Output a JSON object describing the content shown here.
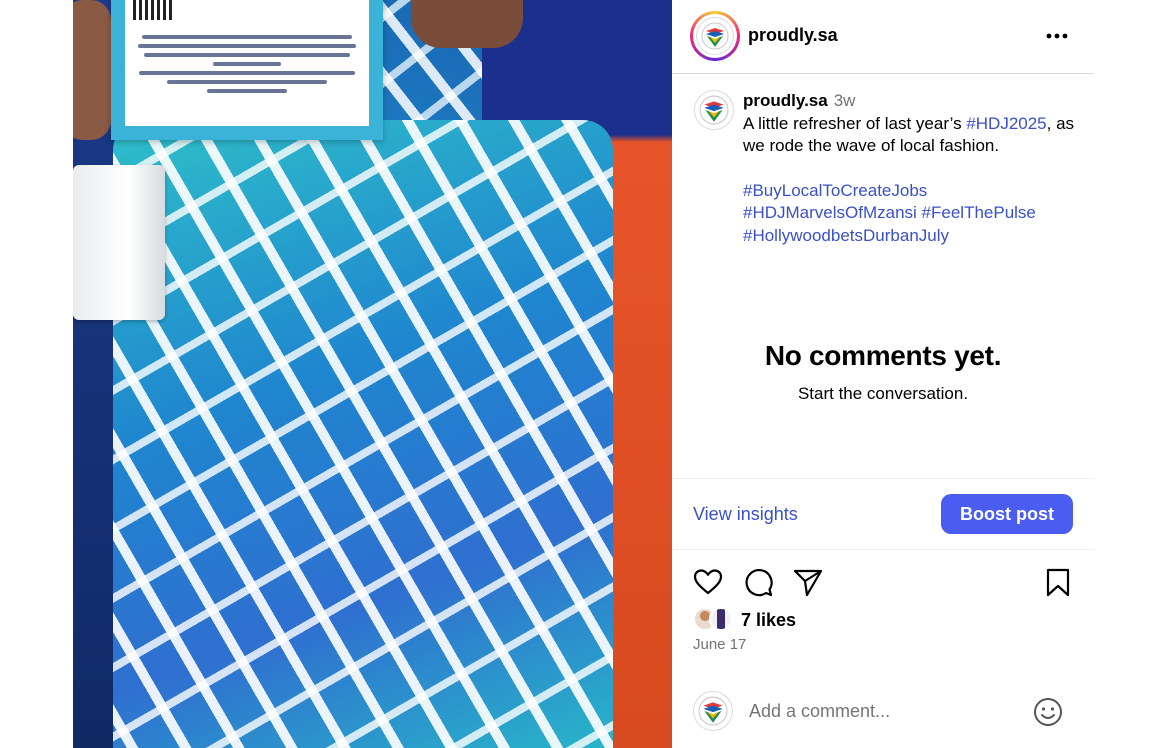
{
  "post": {
    "username": "proudly.sa",
    "more_label": "•••"
  },
  "caption": {
    "username": "proudly.sa",
    "time": "3w",
    "text_before": "A little refresher of last year’s ",
    "tag1": "#HDJ2025",
    "text_after": ", as we rode the wave of local fashion.",
    "tags_line1": "#BuyLocalToCreateJobs",
    "tags_line2a": "#HDJMarvelsOfMzansi",
    "tags_line2b": "#FeelThePulse",
    "tags_line3": "#HollywoodbetsDurbanJuly"
  },
  "empty_state": {
    "heading": "No comments yet.",
    "subtext": "Start the conversation."
  },
  "insights": {
    "view_label": "View insights",
    "boost_label": "Boost post"
  },
  "engagement": {
    "likes": "7 likes",
    "date": "June 17"
  },
  "comment_box": {
    "placeholder": "Add a comment..."
  },
  "icons": {
    "like": "heart-icon",
    "comment": "comment-bubble-icon",
    "share": "paper-plane-icon",
    "save": "bookmark-icon",
    "emoji": "smiley-icon",
    "more": "more-options-icon"
  },
  "colors": {
    "link_blue": "#3a50c9",
    "boost_button": "#4a5df0",
    "muted_text": "#737373",
    "divider": "#dbdbdb"
  }
}
